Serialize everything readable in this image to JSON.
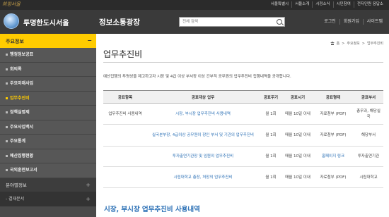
{
  "topbar": {
    "brand": "희망서울",
    "links": [
      "서울특별시",
      "서울소개",
      "시정소식",
      "시민참여",
      "전자민원 응답소"
    ]
  },
  "header": {
    "site_title": "투명한도시서울",
    "section_title": "정보소통광장",
    "search_placeholder": "전체 검색",
    "links": [
      "로그인",
      "회원가입",
      "사이트맵"
    ]
  },
  "sidebar": {
    "main_label": "주요정보",
    "main_toggle": "−",
    "items": [
      {
        "label": "행정정보공표",
        "active": false
      },
      {
        "label": "회의록",
        "active": false
      },
      {
        "label": "주요미래사업",
        "active": false
      },
      {
        "label": "업무추진비",
        "active": true
      },
      {
        "label": "정책실명제",
        "active": false
      },
      {
        "label": "주요사업백서",
        "active": false
      },
      {
        "label": "주요통계",
        "active": false
      },
      {
        "label": "예산집행현황",
        "active": false
      },
      {
        "label": "국외훈련보고서",
        "active": false
      }
    ],
    "group_label": "분야별정보",
    "group_toggle": "+",
    "sub_label": "- 결재문서",
    "sub_toggle": "+"
  },
  "content": {
    "breadcrumb": [
      "홈",
      "주요정보",
      "업무추진비"
    ],
    "breadcrumb_sep": ">",
    "title": "업무추진비",
    "intro": "예산집행의 투명성을 제고하고자 시장 및 4급 이상 부서장 이상 간부직 공무원의 업무추진비 집행내역을 공개합니다.",
    "table": {
      "headers": [
        "공표항목",
        "공표대상 업무",
        "공표주기",
        "공표시기",
        "공표형태",
        "공표부서"
      ],
      "rows": [
        {
          "item": "업무추진비 사용내역",
          "target": "시장, 부시장 업무추진비 사용내역",
          "cycle": "월 1회",
          "timing": "매월 10일 이내",
          "form": "자료첨부 (PDF)",
          "dept": "총무과, 해당실국"
        },
        {
          "item": "",
          "target": "실국본부장, 4급이상 공무원이 장인 부서 및 기관의 업무추진비",
          "cycle": "월 1회",
          "timing": "매월 10일 이내",
          "form": "자료첨부 (PDF)",
          "dept": "해당부서"
        },
        {
          "item": "",
          "target": "투자출연기관장 및 임원의 업무추진비",
          "cycle": "월 1회",
          "timing": "매월 10일 이내",
          "form": "홈페이지 링크",
          "dept": "투자출연기관"
        },
        {
          "item": "",
          "target": "시립대학교 총장, 처장의 업무추진비",
          "cycle": "월 1회",
          "timing": "매월 10일 이내",
          "form": "자료첨부 (PDF)",
          "dept": "시립대학교"
        }
      ]
    },
    "section2_title": "시장, 부시장 업무추진비 사용내역"
  }
}
